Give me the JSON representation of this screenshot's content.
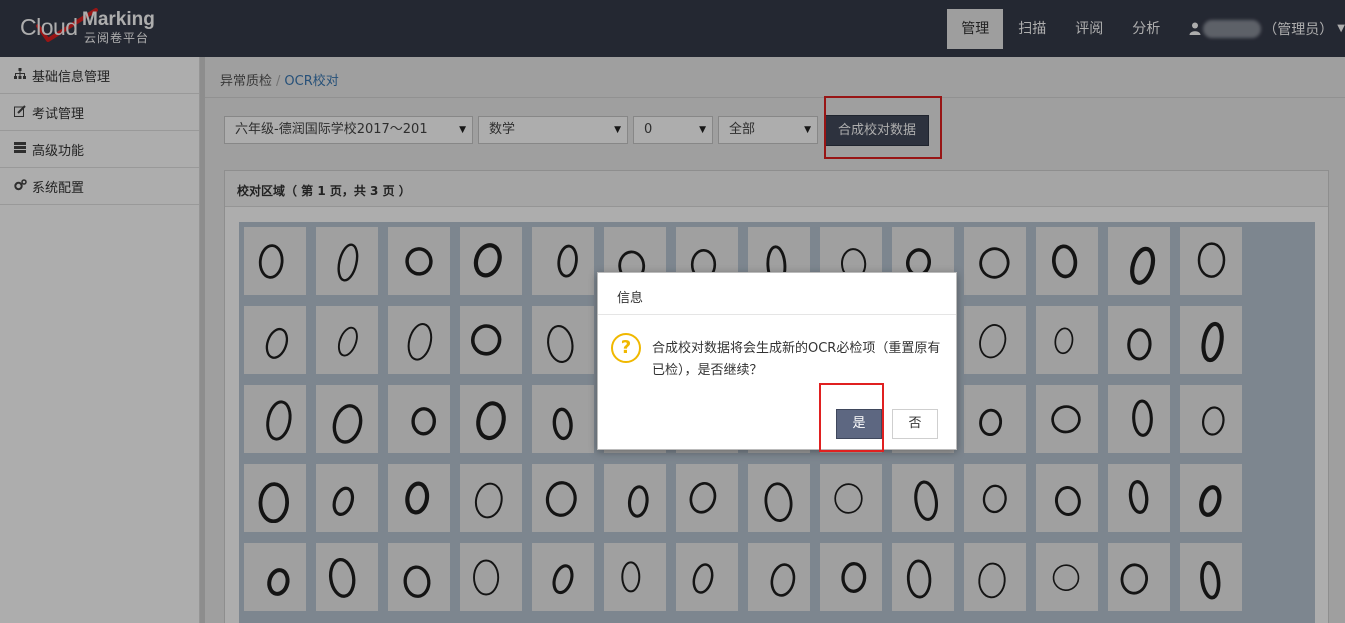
{
  "app": {
    "logo_cloud": "Cloud",
    "logo_marking": "Marking",
    "logo_subtitle": "云阅卷平台"
  },
  "nav": {
    "items": [
      {
        "label": "管理",
        "active": true
      },
      {
        "label": "扫描",
        "active": false
      },
      {
        "label": "评阅",
        "active": false
      },
      {
        "label": "分析",
        "active": false
      }
    ],
    "user_role": "（管理员）"
  },
  "sidebar": {
    "items": [
      {
        "label": "基础信息管理",
        "icon": "sitemap-icon"
      },
      {
        "label": "考试管理",
        "icon": "edit-icon"
      },
      {
        "label": "高级功能",
        "icon": "server-icon"
      },
      {
        "label": "系统配置",
        "icon": "cogs-icon"
      }
    ]
  },
  "breadcrumb": {
    "parent": "异常质检",
    "separator": "/",
    "current": "OCR校对"
  },
  "filters": {
    "exam": "六年级-德润国际学校2017～201",
    "subject": "数学",
    "digit": "0",
    "scope": "全部",
    "merge_button": "合成校对数据"
  },
  "panel": {
    "title": "校对区域（ 第 1 页，共 3 页 ）",
    "tile_digit": "0",
    "tile_rows": 5,
    "tile_cols": 14
  },
  "dialog": {
    "title": "信息",
    "icon": "question-icon",
    "message": "合成校对数据将会生成新的OCR必检项（重置原有已检），是否继续？",
    "yes": "是",
    "no": "否"
  },
  "colors": {
    "topbar": "#363b4a",
    "highlight": "#e02020",
    "primary_button": "#434a5c",
    "link": "#3a78b3",
    "warning_icon": "#f0b800"
  }
}
